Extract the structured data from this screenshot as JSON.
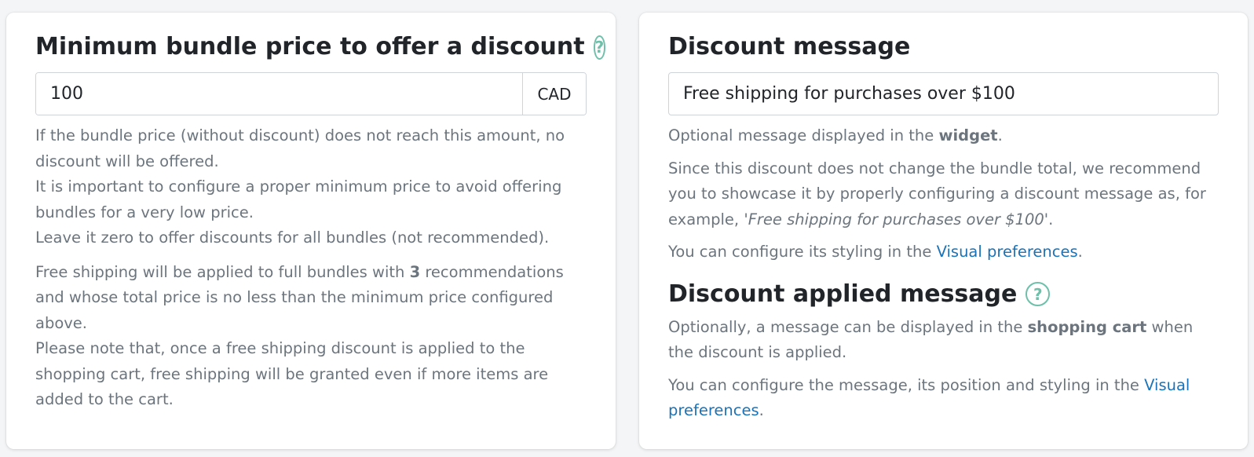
{
  "min_price_section": {
    "title": "Minimum bundle price to offer a discount",
    "help_glyph": "?",
    "input_value": "100",
    "currency": "CAD",
    "desc_1": "If the bundle price (without discount) does not reach this amount, no discount will be offered.",
    "desc_2": "It is important to configure a proper minimum price to avoid offering bundles for a very low price.",
    "desc_3": "Leave it zero to offer discounts for all bundles (not recommended).",
    "free_shipping_prefix": "Free shipping will be applied to full bundles with ",
    "free_shipping_count": "3",
    "free_shipping_suffix": " recommendations and whose total price is no less than the minimum price configured above.",
    "note": "Please note that, once a free shipping discount is applied to the shopping cart, free shipping will be granted even if more items are added to the cart."
  },
  "discount_message_section": {
    "title": "Discount message",
    "input_value": "Free shipping for purchases over $100",
    "optional_prefix": "Optional message displayed in the ",
    "optional_bold": "widget",
    "optional_suffix": ".",
    "since_prefix": "Since this discount does not change the bundle total, we recommend you to showcase it by properly configuring a discount message as, for example, '",
    "since_example": "Free shipping for purchases over $100",
    "since_suffix": "'.",
    "styling_prefix": "You can configure its styling in the ",
    "styling_link": "Visual preferences",
    "styling_suffix": "."
  },
  "discount_applied_section": {
    "title": "Discount applied message",
    "help_glyph": "?",
    "optional_prefix": "Optionally, a message can be displayed in the ",
    "optional_bold": "shopping cart",
    "optional_suffix": " when the discount is applied.",
    "configure_prefix": "You can configure the message, its position and styling in the ",
    "configure_link": "Visual preferences",
    "configure_suffix": "."
  },
  "colors": {
    "help_icon": "#6fbfa9",
    "link": "#1a73b8",
    "muted_text": "#6c757d"
  }
}
